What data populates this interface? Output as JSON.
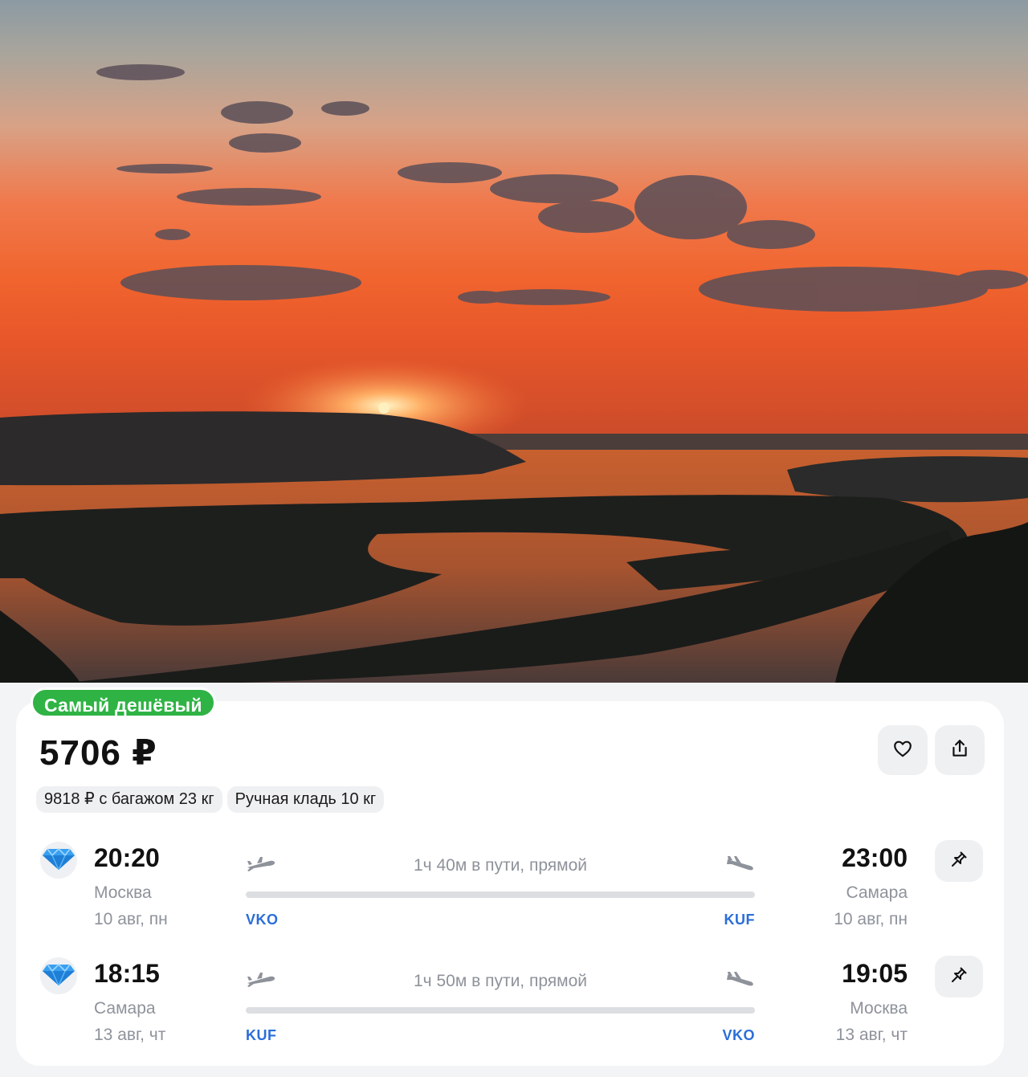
{
  "badge": {
    "label": "Самый дешёвый",
    "color": "#2fb344"
  },
  "price": {
    "amount": "5706 ₽"
  },
  "actions": {
    "favorite_icon": "heart-icon",
    "share_icon": "share-icon"
  },
  "chips": [
    {
      "label": "9818 ₽ с багажом 23 кг"
    },
    {
      "label": "Ручная кладь 10 кг"
    }
  ],
  "segments": [
    {
      "airline_icon": "diamond-icon",
      "departure": {
        "time": "20:20",
        "city": "Москва",
        "date": "10 авг, пн",
        "iata": "VKO"
      },
      "arrival": {
        "time": "23:00",
        "city": "Самара",
        "date": "10 авг, пн",
        "iata": "KUF"
      },
      "duration": "1ч 40м в пути, прямой",
      "pin_icon": "pin-icon"
    },
    {
      "airline_icon": "diamond-icon",
      "departure": {
        "time": "18:15",
        "city": "Самара",
        "date": "13 авг, чт",
        "iata": "KUF"
      },
      "arrival": {
        "time": "19:05",
        "city": "Москва",
        "date": "13 авг, чт",
        "iata": "VKO"
      },
      "duration": "1ч 50м в пути, прямой",
      "pin_icon": "pin-icon"
    }
  ],
  "colors": {
    "accent_link": "#2b6ed9",
    "muted_text": "#8e929a",
    "sunset_sky": "#f0642e"
  }
}
